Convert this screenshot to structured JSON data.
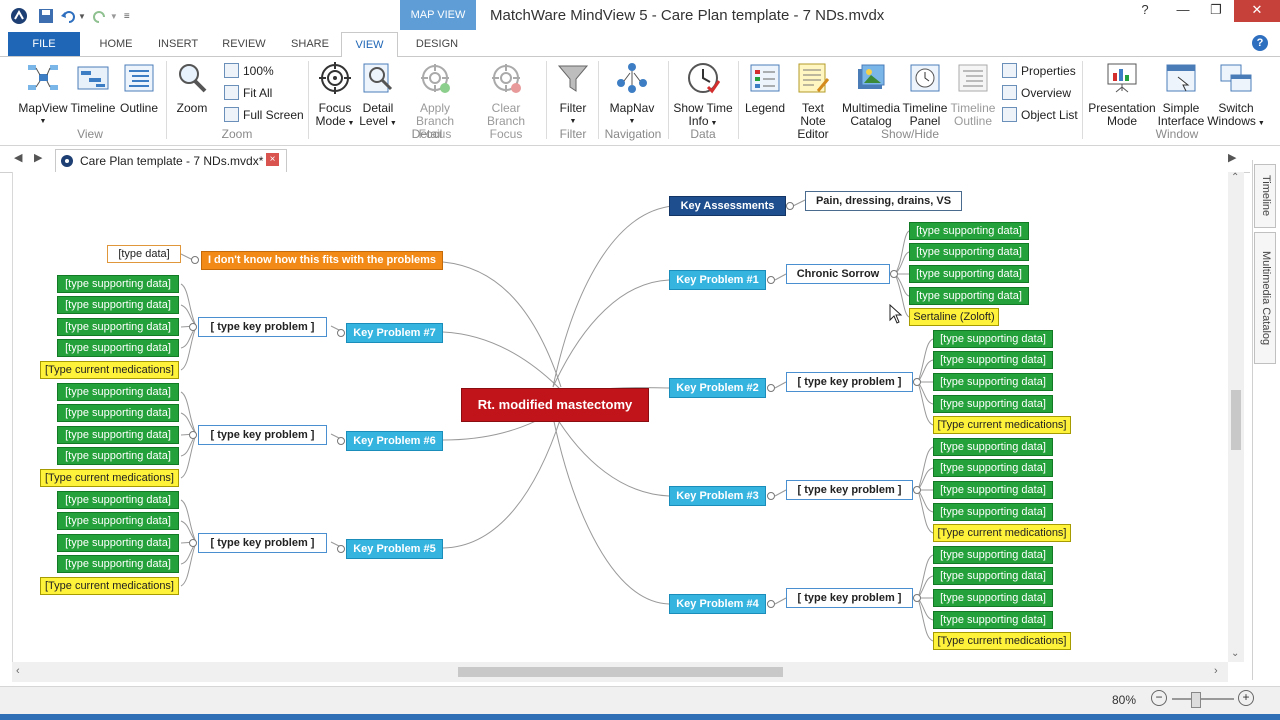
{
  "titlebar": {
    "map_view_tab": "MAP VIEW",
    "title": "MatchWare MindView 5 - Care Plan template - 7 NDs.mvdx"
  },
  "menu": {
    "file": "FILE",
    "home": "HOME",
    "insert": "INSERT",
    "review": "REVIEW",
    "share": "SHARE",
    "view": "VIEW",
    "design": "DESIGN",
    "help": "?"
  },
  "ribbon": {
    "mapview": "MapView",
    "timeline": "Timeline",
    "outline": "Outline",
    "view_group": "View",
    "zoom": "Zoom",
    "zoom_100": "100%",
    "fit_all": "Fit All",
    "full_screen": "Full Screen",
    "zoom_group": "Zoom",
    "focus_mode_1": "Focus",
    "focus_mode_2": "Mode",
    "detail_level_1": "Detail",
    "detail_level_2": "Level",
    "apply_branch_1": "Apply Branch",
    "apply_branch_2": "Focus",
    "clear_branch_1": "Clear Branch",
    "clear_branch_2": "Focus",
    "detail_group": "Detail",
    "filter": "Filter",
    "filter_group": "Filter",
    "mapnav": "MapNav",
    "navigation_group": "Navigation",
    "show_time_1": "Show Time",
    "show_time_2": "Info",
    "data_group": "Data",
    "legend": "Legend",
    "text_note_1": "Text Note",
    "text_note_2": "Editor",
    "multimedia_1": "Multimedia",
    "multimedia_2": "Catalog",
    "timeline_panel_1": "Timeline",
    "timeline_panel_2": "Panel",
    "timeline_outline_1": "Timeline",
    "timeline_outline_2": "Outline",
    "properties": "Properties",
    "overview": "Overview",
    "object_list": "Object List",
    "showhide_group": "Show/Hide",
    "presentation_1": "Presentation",
    "presentation_2": "Mode",
    "simple_1": "Simple",
    "simple_2": "Interface",
    "switch_1": "Switch",
    "switch_2": "Windows",
    "window_group": "Window"
  },
  "doc_tab": {
    "label": "Care Plan template - 7 NDs.mvdx*",
    "close": "×"
  },
  "side_tabs": {
    "timeline": "Timeline",
    "multimedia": "Multimedia Catalog"
  },
  "status": {
    "zoom": "80%",
    "minus": "−",
    "plus": "+"
  },
  "colors": {
    "root": "#c0141a",
    "key_problem": "#36b4e0",
    "support": "#24a13a",
    "meds": "#fff23a",
    "orange": "#f28a17",
    "assess": "#1f4e8e"
  },
  "map": {
    "root": "Rt. modified mastectomy",
    "key_assessments": "Key Assessments",
    "assess_detail": "Pain, dressing, drains, VS",
    "kp1": "Key Problem #1",
    "kp1_detail": "Chronic Sorrow",
    "kp2": "Key Problem #2",
    "kp3": "Key Problem #3",
    "kp4": "Key Problem #4",
    "kp5": "Key Problem #5",
    "kp6": "Key Problem #6",
    "kp7": "Key Problem #7",
    "type_key_problem": "[ type key problem ]",
    "support": "[type supporting data]",
    "meds": "[Type current medications]",
    "sertaline": "Sertaline (Zoloft)",
    "orange": "I don't know how this fits with the problems",
    "type_data": "[type data]"
  }
}
